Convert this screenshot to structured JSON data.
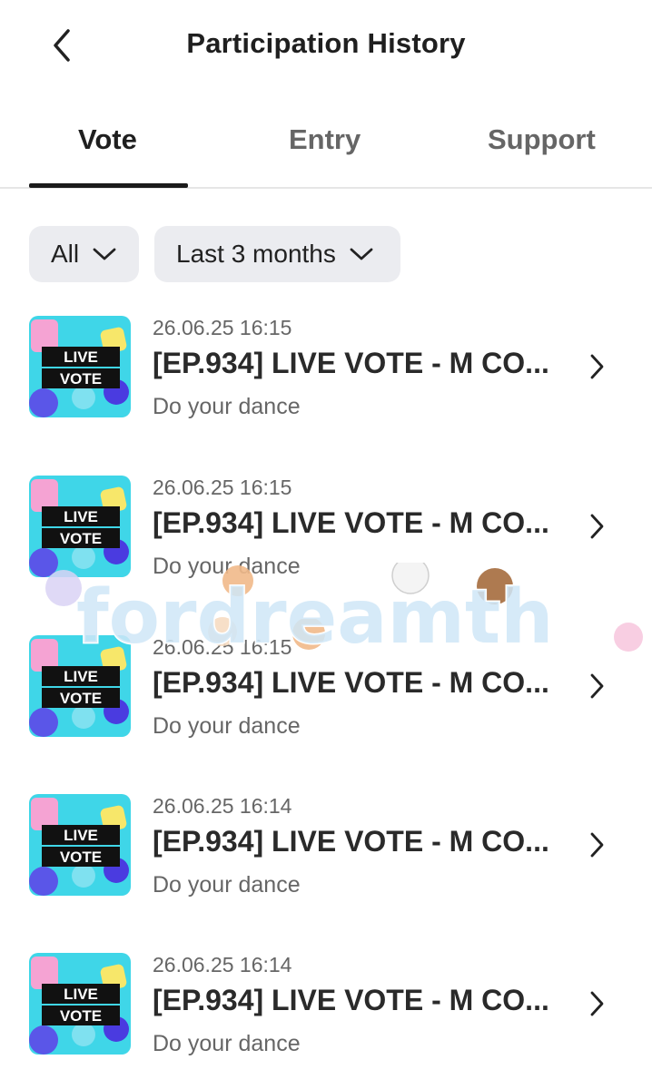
{
  "header": {
    "title": "Participation History"
  },
  "tabs": [
    {
      "label": "Vote",
      "active": true
    },
    {
      "label": "Entry",
      "active": false
    },
    {
      "label": "Support",
      "active": false
    }
  ],
  "filters": {
    "type": "All",
    "period": "Last 3 months"
  },
  "items": [
    {
      "date": "26.06.25 16:15",
      "title": "[EP.934] LIVE VOTE - M CO...",
      "subtitle": "Do your dance",
      "thumb_line1": "LIVE",
      "thumb_line2": "VOTE"
    },
    {
      "date": "26.06.25 16:15",
      "title": "[EP.934] LIVE VOTE - M CO...",
      "subtitle": "Do your dance",
      "thumb_line1": "LIVE",
      "thumb_line2": "VOTE"
    },
    {
      "date": "26.06.25 16:15",
      "title": "[EP.934] LIVE VOTE - M CO...",
      "subtitle": "Do your dance",
      "thumb_line1": "LIVE",
      "thumb_line2": "VOTE"
    },
    {
      "date": "26.06.25 16:14",
      "title": "[EP.934] LIVE VOTE - M CO...",
      "subtitle": "Do your dance",
      "thumb_line1": "LIVE",
      "thumb_line2": "VOTE"
    },
    {
      "date": "26.06.25 16:14",
      "title": "[EP.934] LIVE VOTE - M CO...",
      "subtitle": "Do your dance",
      "thumb_line1": "LIVE",
      "thumb_line2": "VOTE"
    }
  ],
  "watermark": {
    "text": "fordreamth"
  },
  "colors": {
    "filter_bg": "#ebecf0",
    "active_tab": "#1f1f1f",
    "inactive_tab": "#666666",
    "thumb_bg": "#3fd6e8"
  }
}
